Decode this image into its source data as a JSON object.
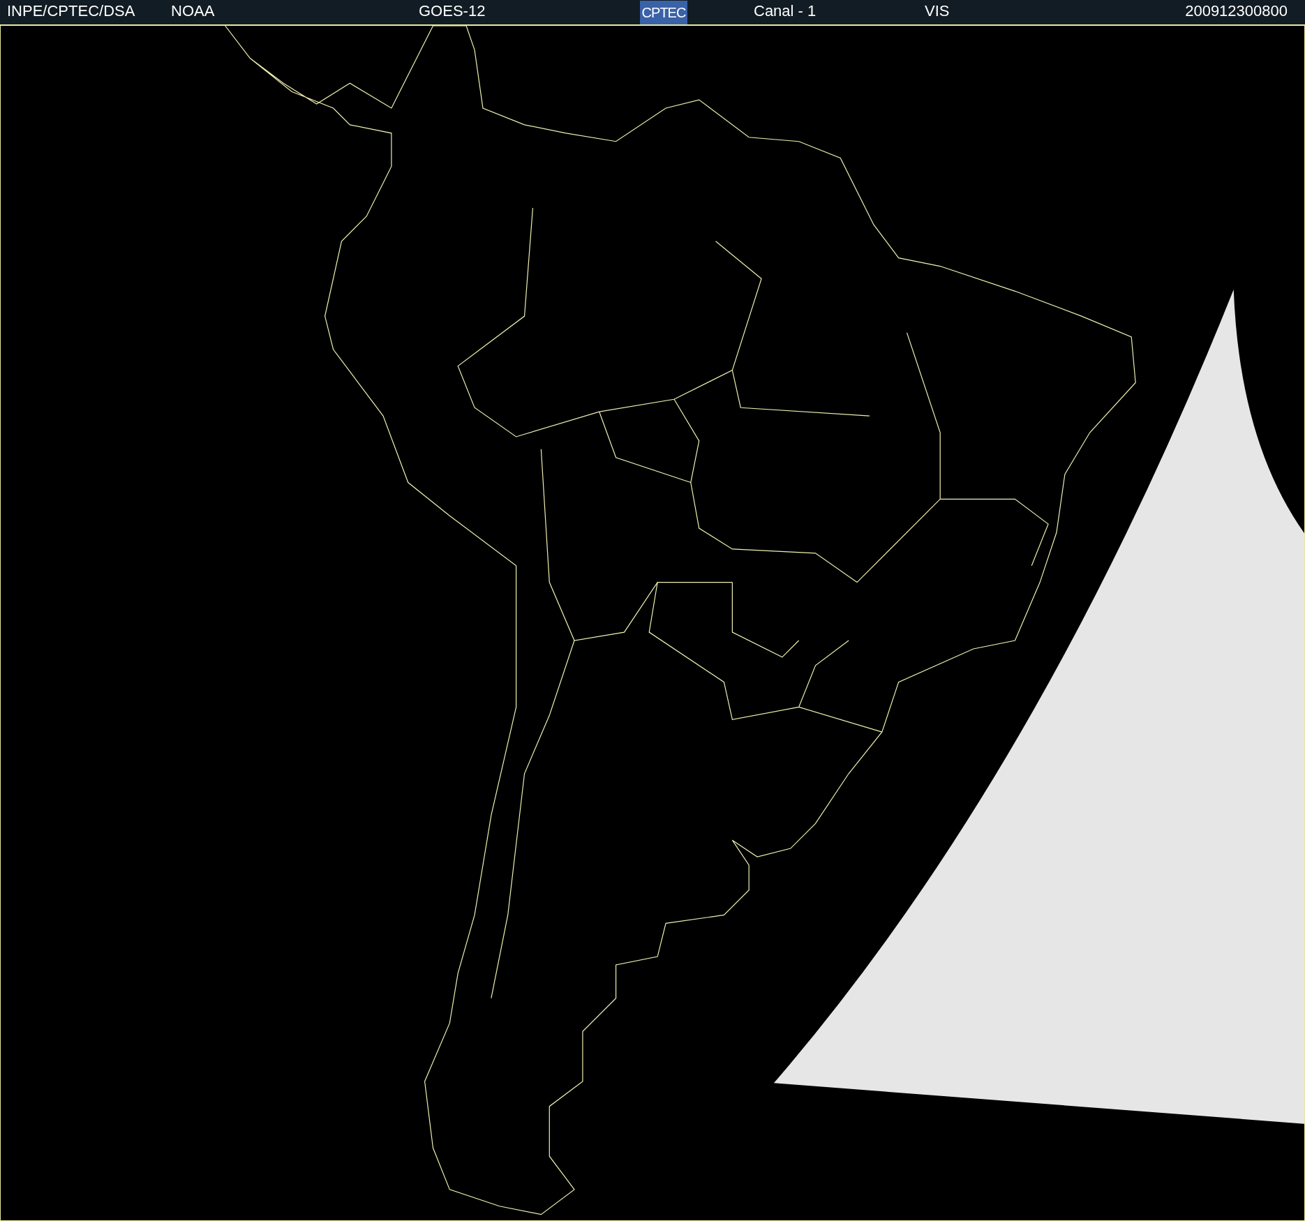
{
  "header": {
    "source": "INPE/CPTEC/DSA",
    "agency": "NOAA",
    "satellite": "GOES-12",
    "logo": "CPTEC",
    "channel": "Canal - 1",
    "band": "VIS",
    "timestamp": "200912300800"
  }
}
